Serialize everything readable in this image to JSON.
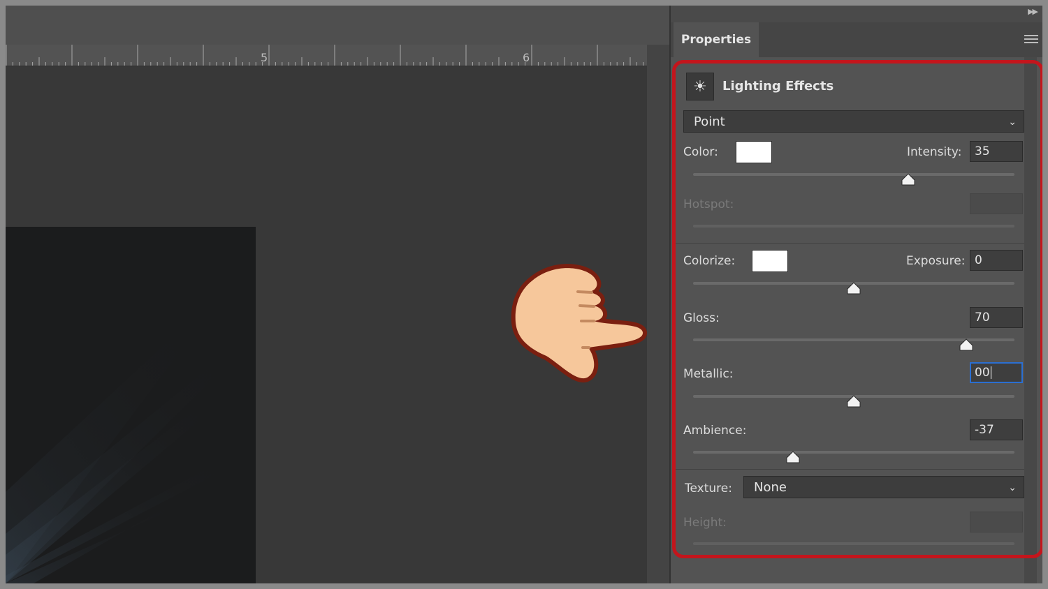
{
  "canvas": {
    "ruler_marks": [
      "5",
      "6"
    ]
  },
  "panel": {
    "tab_label": "Properties",
    "collapse_icon": "double-chevron-right-icon",
    "menu_icon": "hamburger-menu-icon",
    "effect_title": "Lighting Effects",
    "effect_icon": "light-bulb-sun-icon",
    "light_type": "Point",
    "color_label": "Color:",
    "color_value": "#ffffff",
    "intensity_label": "Intensity:",
    "intensity_value": "35",
    "intensity_level": 0.67,
    "hotspot_label": "Hotspot:",
    "hotspot_value": "",
    "colorize_label": "Colorize:",
    "colorize_value": "#ffffff",
    "exposure_label": "Exposure:",
    "exposure_value": "0",
    "exposure_level": 0.5,
    "gloss_label": "Gloss:",
    "gloss_value": "70",
    "gloss_level": 0.85,
    "metallic_label": "Metallic:",
    "metallic_value": "00",
    "metallic_level": 0.5,
    "ambience_label": "Ambience:",
    "ambience_value": "-37",
    "ambience_level": 0.31,
    "texture_label": "Texture:",
    "texture_value": "None",
    "height_label": "Height:",
    "height_value": ""
  },
  "colors": {
    "highlight_border": "#c4151c",
    "focus_border": "#2b6fd1"
  }
}
